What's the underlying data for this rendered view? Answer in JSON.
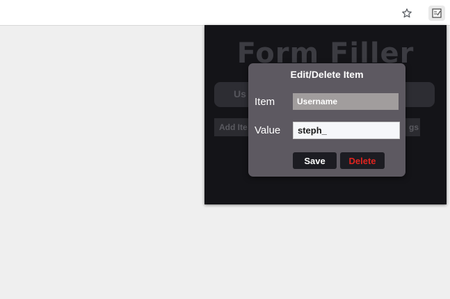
{
  "browser": {
    "bookmark_icon": "star-icon",
    "extension_icon": "form-filler-extension-icon"
  },
  "popup": {
    "title": "Form Filler",
    "background_row_label": "Us",
    "add_button_label": "Add Ite",
    "settings_button_label": "gs"
  },
  "modal": {
    "title": "Edit/Delete Item",
    "item_label": "Item",
    "item_value": "Username",
    "value_label": "Value",
    "value_value": "steph_",
    "save_label": "Save",
    "delete_label": "Delete"
  },
  "colors": {
    "popup_background": "#141418",
    "modal_background": "#5d5961",
    "delete_text": "#e0241f"
  }
}
